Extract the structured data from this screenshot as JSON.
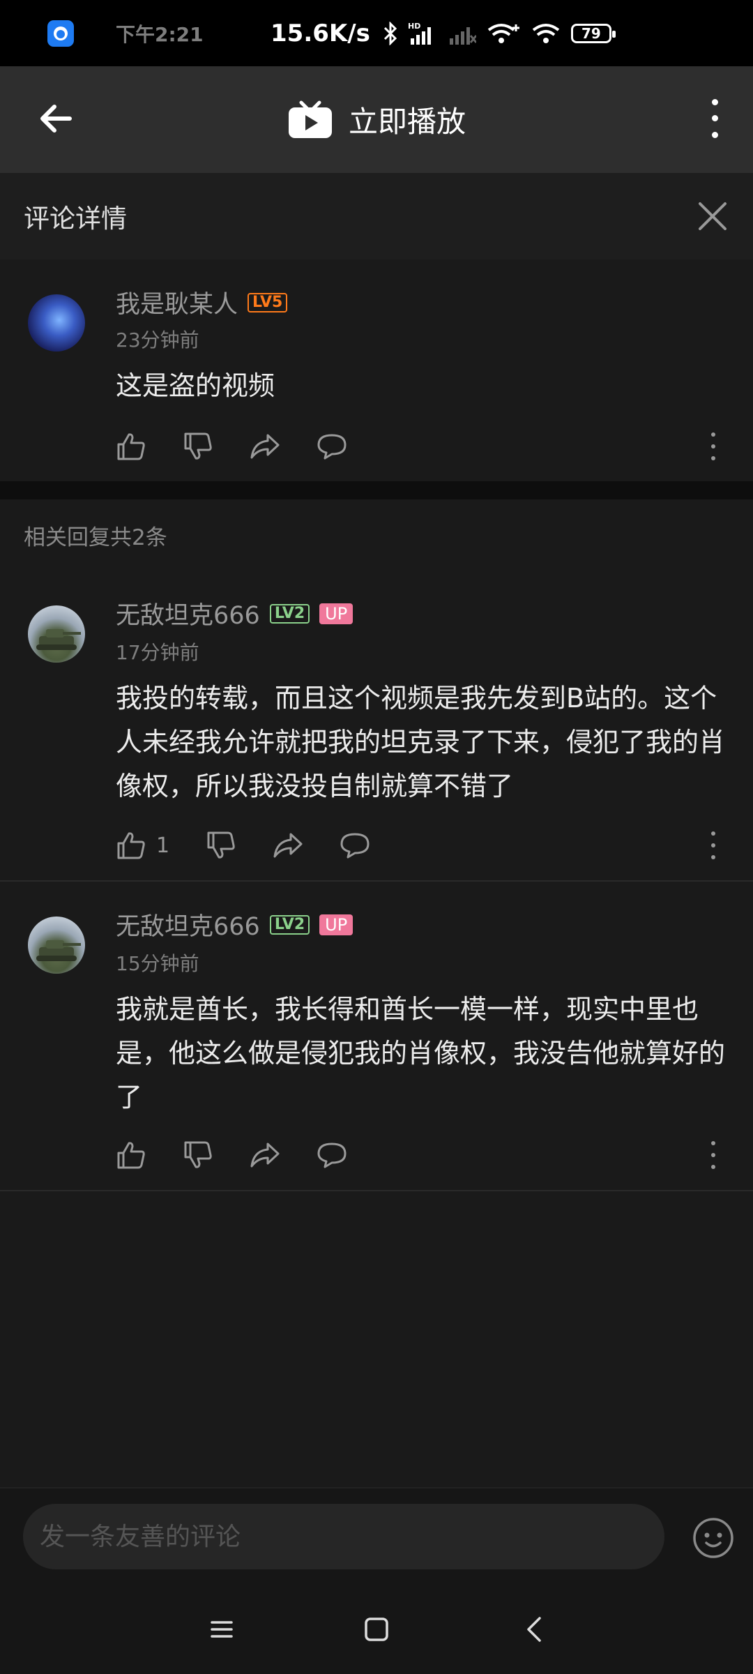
{
  "status_bar": {
    "time": "下午2:21",
    "network_speed": "15.6K/s",
    "battery": "79",
    "icons": [
      "app-notification-icon",
      "bluetooth-icon",
      "signal-icon",
      "signal-off-icon",
      "wifi-plus-icon",
      "wifi-icon",
      "battery-icon"
    ]
  },
  "top_bar": {
    "title": "立即播放",
    "icons": [
      "back-arrow-icon",
      "tv-play-icon",
      "more-vertical-icon"
    ]
  },
  "detail_header": {
    "title": "评论详情",
    "icons": [
      "close-icon"
    ]
  },
  "main_comment": {
    "username": "我是耿某人",
    "level": "LV5",
    "time": "23分钟前",
    "content": "这是盗的视频",
    "likes": ""
  },
  "replies_label": "相关回复共2条",
  "replies": [
    {
      "username": "无敌坦克666",
      "level": "LV2",
      "badge": "UP",
      "time": "17分钟前",
      "content": "我投的转载，而且这个视频是我先发到B站的。这个人未经我允许就把我的坦克录了下来，侵犯了我的肖像权，所以我没投自制就算不错了",
      "likes": "1"
    },
    {
      "username": "无敌坦克666",
      "level": "LV2",
      "badge": "UP",
      "time": "15分钟前",
      "content": "我就是酋长，我长得和酋长一模一样，现实中里也是，他这么做是侵犯我的肖像权，我没告他就算好的了",
      "likes": ""
    }
  ],
  "comment_input": {
    "placeholder": "发一条友善的评论"
  },
  "colors": {
    "background": "#1a1a1a",
    "top_bar": "#2e2e2e",
    "up_badge": "#f0789b",
    "level5": "#ff7a1a",
    "level2": "#8bd18b"
  }
}
